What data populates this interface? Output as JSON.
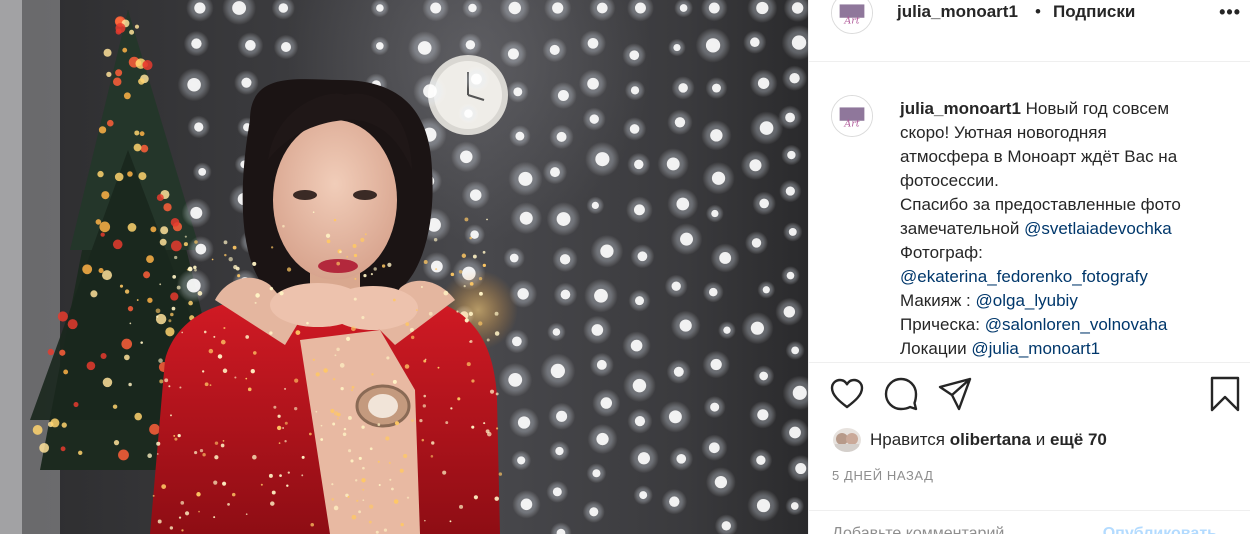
{
  "post": {
    "author": "julia_monoart1",
    "separator": "•",
    "follow_label": "Подписки",
    "more_label": "•••"
  },
  "caption": {
    "author": "julia_monoart1",
    "lines": [
      {
        "text": "Новый год совсем"
      },
      {
        "text": "скоро! Уютная новогодняя"
      },
      {
        "text": "атмосфера в Моноарт ждёт Вас на"
      },
      {
        "text": "фотосессии."
      },
      {
        "text": "Спасибо за предоставленные фото"
      },
      {
        "text": "замечательной ",
        "mention": "@svetlaiadevochka"
      },
      {
        "text": "Фотограф:"
      },
      {
        "text": "",
        "mention": "@ekaterina_fedorenko_fotografy"
      },
      {
        "text": "Макияж : ",
        "mention": "@olga_lyubiy"
      },
      {
        "text": "Прическа: ",
        "mention": "@salonloren_volnovaha"
      },
      {
        "text": "Локации ",
        "mention": "@julia_monoart1"
      }
    ]
  },
  "actions": {
    "icons": [
      "heart-icon",
      "comment-icon",
      "share-icon",
      "bookmark-icon"
    ]
  },
  "likes": {
    "prefix": "Нравится",
    "user": "olibertana",
    "conjunction": "и",
    "others": "ещё 70"
  },
  "timestamp": "5 ДНЕЙ НАЗАД",
  "comment": {
    "placeholder": "Добавьте комментарий...",
    "post_label": "Опубликовать"
  },
  "colors": {
    "text": "#262626",
    "secondary": "#8e8e8e",
    "mention": "#00376b",
    "border": "#efefef",
    "post_disabled": "#b3dbff"
  }
}
